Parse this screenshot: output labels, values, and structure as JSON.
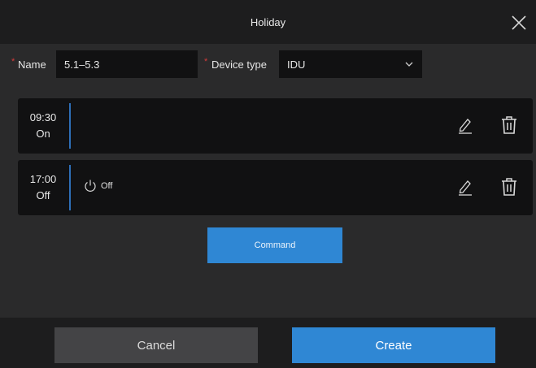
{
  "dialog": {
    "title": "Holiday",
    "close_icon": "close-icon"
  },
  "form": {
    "name_label": "Name",
    "name_value": "5.1–5.3",
    "device_type_label": "Device type",
    "device_type_value": "IDU",
    "required_marker": "*"
  },
  "schedule": [
    {
      "time": "09:30",
      "state": "On",
      "command": ""
    },
    {
      "time": "17:00",
      "state": "Off",
      "command": "Off"
    }
  ],
  "command_button": "Command",
  "footer": {
    "cancel_label": "Cancel",
    "create_label": "Create"
  },
  "colors": {
    "accent": "#2f87d4",
    "background": "#2a2a2b",
    "card": "#111112",
    "required": "#d23b3b"
  }
}
